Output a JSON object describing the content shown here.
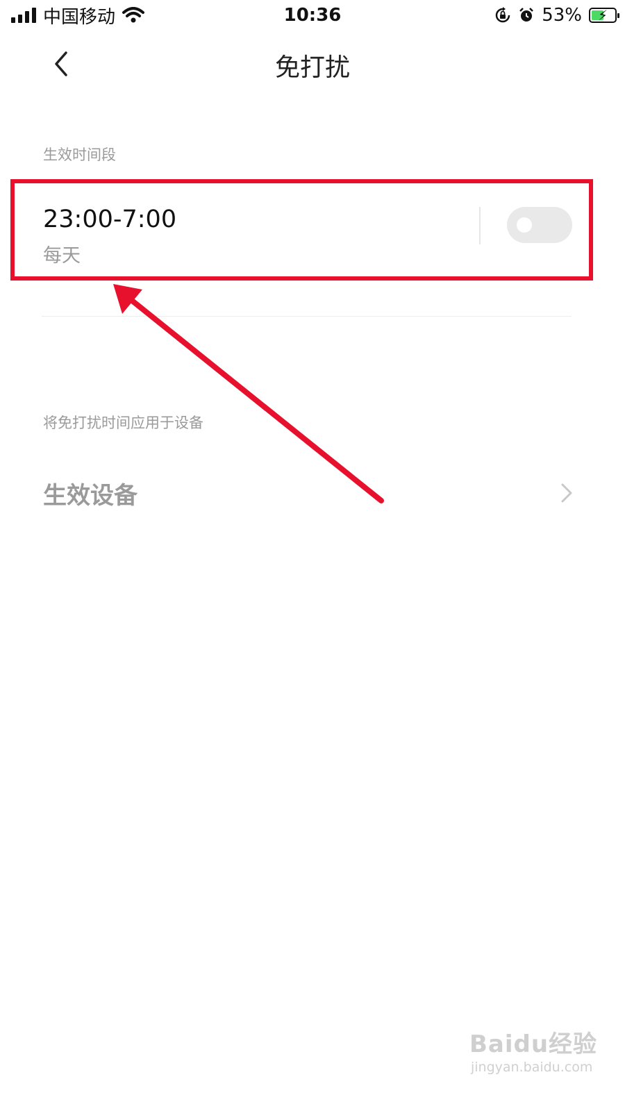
{
  "status_bar": {
    "carrier": "中国移动",
    "time": "10:36",
    "battery_percent": "53%",
    "battery_level": 0.53,
    "icons": [
      "signal-icon",
      "wifi-icon",
      "rotation-lock-icon",
      "alarm-icon",
      "battery-charging-icon"
    ]
  },
  "nav": {
    "title": "免打扰",
    "back_icon": "chevron-left-icon"
  },
  "schedule_section": {
    "label": "生效时间段",
    "item": {
      "time_range": "23:00-7:00",
      "repeat": "每天",
      "enabled": false
    }
  },
  "devices_section": {
    "label": "将免打扰时间应用于设备",
    "item_label": "生效设备",
    "chevron_icon": "chevron-right-icon"
  },
  "annotation": {
    "color": "#e8112d",
    "type": "arrow-and-box"
  },
  "watermark": {
    "logo": "Baidu经验",
    "url": "jingyan.baidu.com"
  }
}
